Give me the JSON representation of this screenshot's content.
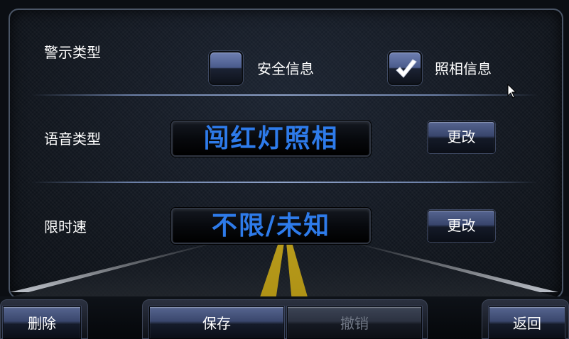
{
  "warning_type": {
    "label": "警示类型",
    "options": [
      {
        "label": "安全信息",
        "checked": false
      },
      {
        "label": "照相信息",
        "checked": true
      }
    ]
  },
  "voice_type": {
    "label": "语音类型",
    "value": "闯红灯照相",
    "change_label": "更改"
  },
  "speed_limit": {
    "label": "限时速",
    "value": "不限/未知",
    "change_label": "更改"
  },
  "bottom_bar": {
    "delete_label": "删除",
    "save_label": "保存",
    "undo_label": "撤销",
    "undo_enabled": false,
    "back_label": "返回"
  },
  "colors": {
    "display_text": "#2e7bea",
    "button_top": "#566591",
    "separator": "#8fa3c9",
    "road_line": "#c8a81a"
  }
}
